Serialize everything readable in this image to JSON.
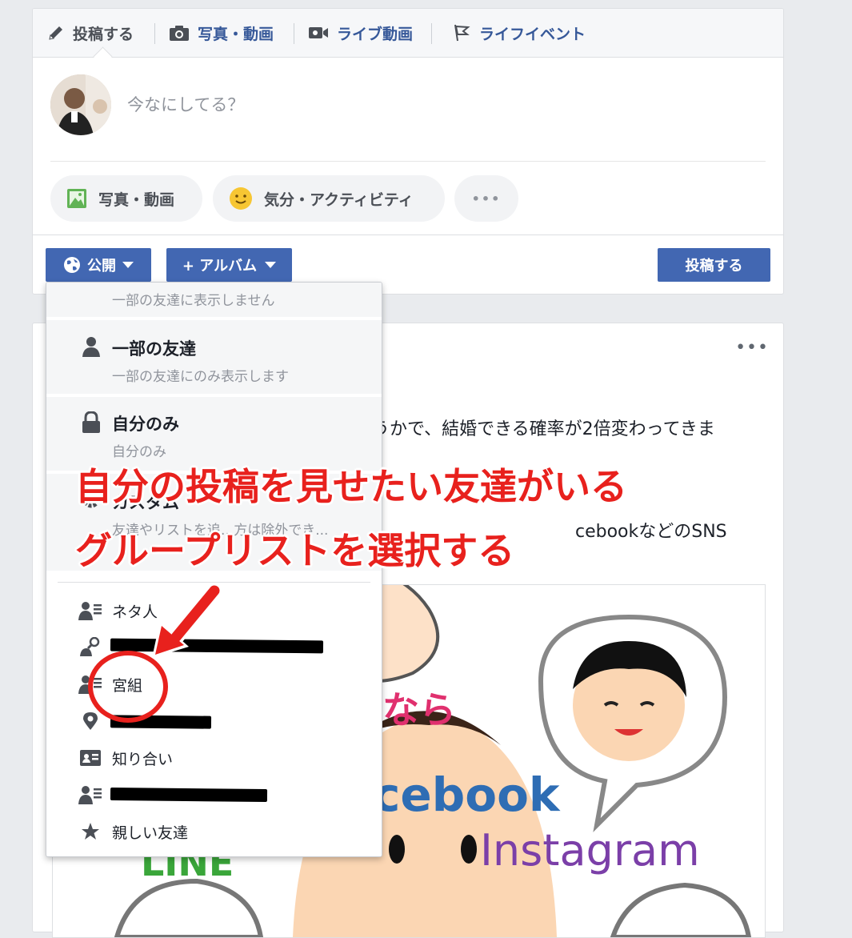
{
  "composer": {
    "tabs": [
      {
        "label": "投稿する",
        "icon": "pencil-icon"
      },
      {
        "label": "写真・動画",
        "icon": "camera-icon"
      },
      {
        "label": "ライブ動画",
        "icon": "video-camera-icon"
      },
      {
        "label": "ライフイベント",
        "icon": "flag-icon"
      }
    ],
    "prompt": "今なにしてる？",
    "pills": [
      {
        "label": "写真・動画",
        "icon": "photo-icon"
      },
      {
        "label": "気分・アクティビティ",
        "icon": "smiley-icon"
      },
      {
        "label": "•••",
        "icon": "more-icon"
      }
    ],
    "audience_label": "公開",
    "album_label": "+ アルバム",
    "post_button": "投稿する"
  },
  "dropdown": {
    "top_sub": "一部の友達に表示しません",
    "options": [
      {
        "title": "一部の友達",
        "sub": "一部の友達にのみ表示します",
        "icon": "person-icon"
      },
      {
        "title": "自分のみ",
        "sub": "自分のみ",
        "icon": "lock-icon"
      },
      {
        "title": "カスタム",
        "sub": "友達やリストを追...方は除外でき...",
        "icon": "gear-icon"
      }
    ],
    "lists": [
      {
        "label": "ネタ人",
        "icon": "list-person-icon"
      },
      {
        "label": "",
        "icon": "person-search-icon",
        "redacted": true
      },
      {
        "label": "宮組",
        "icon": "list-person-icon"
      },
      {
        "label": "",
        "icon": "location-pin-icon",
        "redacted": true
      },
      {
        "label": "知り合い",
        "icon": "id-card-icon"
      },
      {
        "label": "",
        "icon": "list-person-icon",
        "redacted": true
      },
      {
        "label": "親しい友達",
        "icon": "star-icon"
      }
    ]
  },
  "feed": {
    "more": "•••",
    "line1": "うかで、結婚できる確率が2倍変わってきま",
    "line2": "cebookなどのSNS",
    "image_text": [
      "なら",
      "cebook",
      "Instagram",
      "LINE"
    ]
  },
  "annotation": {
    "line1": "自分の投稿を見せたい友達がいる",
    "line2": "グループリストを選択する"
  },
  "colors": {
    "brand": "#4267b2",
    "annotation": "#e8211d",
    "link": "#365899"
  }
}
